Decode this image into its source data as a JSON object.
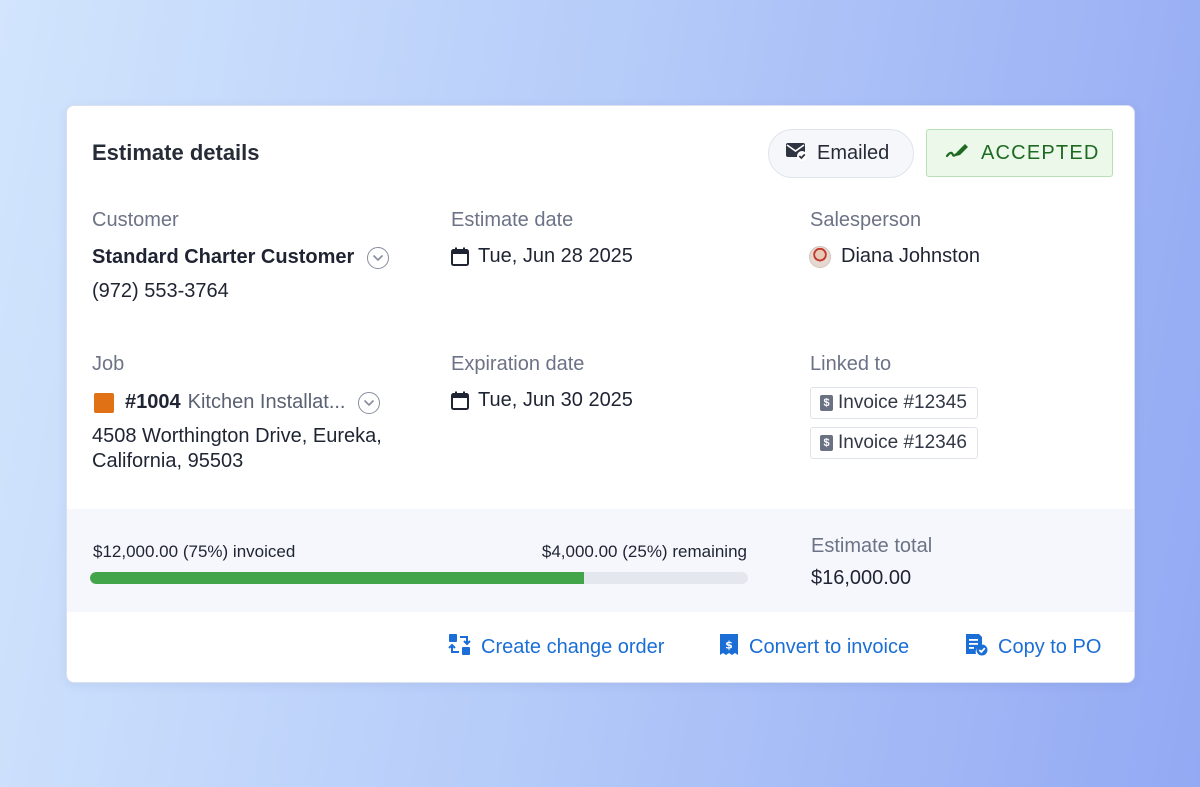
{
  "card": {
    "title": "Estimate details",
    "emailed_label": "Emailed",
    "status_label": "ACCEPTED"
  },
  "customer": {
    "label": "Customer",
    "name": "Standard Charter Customer",
    "phone": "(972) 553-3764"
  },
  "estimate_date": {
    "label": "Estimate date",
    "value": "Tue, Jun 28 2025"
  },
  "salesperson": {
    "label": "Salesperson",
    "name": "Diana Johnston"
  },
  "job": {
    "label": "Job",
    "number": "#1004",
    "name": "Kitchen Installat...",
    "address_line1": "4508 Worthington Drive, Eureka,",
    "address_line2": "California, 95503"
  },
  "expiration_date": {
    "label": "Expiration date",
    "value": "Tue, Jun 30 2025"
  },
  "linked": {
    "label": "Linked to",
    "invoices": [
      "Invoice #12345",
      "Invoice #12346"
    ]
  },
  "progress": {
    "invoiced_amount": "$12,000.00",
    "invoiced_pct_text": "(75%)",
    "invoiced_word": "invoiced",
    "remaining_amount": "$4,000.00",
    "remaining_pct_text": "(25%)",
    "remaining_word": "remaining",
    "fraction": 0.75
  },
  "total": {
    "label": "Estimate total",
    "value": "$16,000.00"
  },
  "actions": {
    "change_order": "Create change order",
    "convert_invoice": "Convert to invoice",
    "copy_po": "Copy to PO"
  },
  "colors": {
    "accent": "#1a6ed6",
    "accepted_bg": "#ebf8ea",
    "accepted_text": "#1e6a21",
    "progress_fill": "#43a54a",
    "job_color": "#e07114"
  },
  "icons": {
    "emailed": "email-check-icon",
    "accepted": "signature-pen-icon",
    "date": "calendar-icon",
    "chevron": "chevron-down-circle-icon",
    "invoice": "dollar-document-icon",
    "change_order": "swap-arrows-icon",
    "convert": "receipt-dollar-icon",
    "copy_po": "document-check-icon"
  }
}
